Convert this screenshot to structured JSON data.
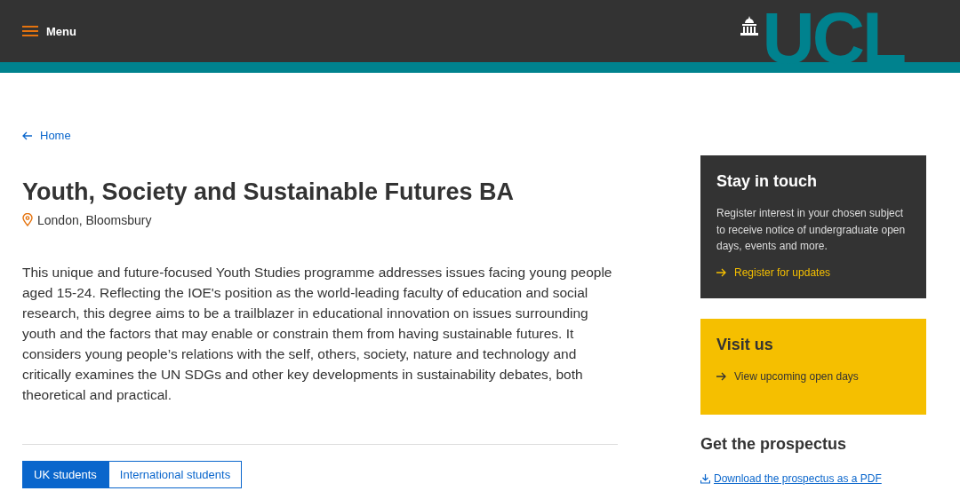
{
  "header": {
    "menu_label": "Menu",
    "logo_text": "UCL"
  },
  "breadcrumb": {
    "label": "Home"
  },
  "title": "Youth, Society and Sustainable Futures BA",
  "location": "London, Bloomsbury",
  "description": "This unique and future-focused Youth Studies programme addresses issues facing young people aged 15-24. Reflecting the IOE's position as the world-leading faculty of education and social research, this degree aims to be a trailblazer in educational innovation on issues surrounding youth and the factors that may enable or constrain them from having sustainable futures. It considers young people’s relations with the self, others, society, nature and technology and critically examines the UN SDGs and other key developments in sustainability debates, both theoretical and practical.",
  "tabs": [
    {
      "label": "UK students",
      "selected": true
    },
    {
      "label": "International students",
      "selected": false
    }
  ],
  "sidebar": [
    {
      "kind": "dark",
      "title": "Stay in touch",
      "text": "Register interest in your chosen subject to receive notice of undergraduate open days, events and more.",
      "link": "Register for updates"
    },
    {
      "kind": "yellow",
      "title": "Visit us",
      "link": "View upcoming open days"
    },
    {
      "kind": "plain",
      "title": "Get the prospectus",
      "link": "Download the prospectus as a PDF"
    }
  ]
}
